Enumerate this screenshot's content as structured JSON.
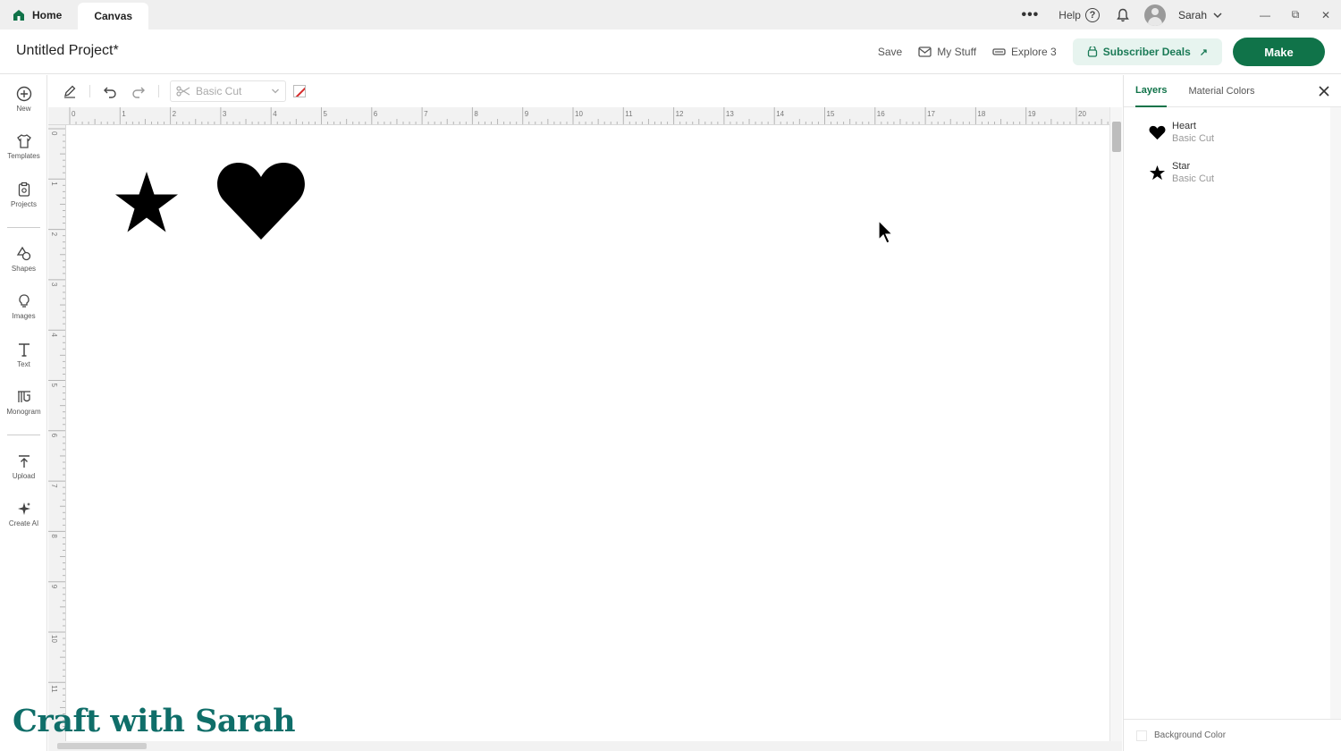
{
  "titlebar": {
    "tabs": [
      {
        "label": "Home"
      },
      {
        "label": "Canvas"
      }
    ],
    "more": "•••",
    "help_label": "Help",
    "help_glyph": "?",
    "user_name": "Sarah",
    "window_controls": {
      "minimize": "—",
      "restore": "⧉",
      "close": "✕"
    }
  },
  "header": {
    "project_title": "Untitled Project*",
    "save_label": "Save",
    "mystuff_label": "My Stuff",
    "machine_label": "Explore 3",
    "deals_label": "Subscriber Deals",
    "deals_arrow": "↗",
    "make_label": "Make"
  },
  "rail": {
    "items": [
      {
        "label": "New",
        "icon": "plus-circle-icon"
      },
      {
        "label": "Templates",
        "icon": "shirt-icon"
      },
      {
        "label": "Projects",
        "icon": "clipboard-icon"
      },
      {
        "label": "Shapes",
        "icon": "shapes-icon"
      },
      {
        "label": "Images",
        "icon": "lightbulb-icon"
      },
      {
        "label": "Text",
        "icon": "text-icon"
      },
      {
        "label": "Monogram",
        "icon": "monogram-icon"
      },
      {
        "label": "Upload",
        "icon": "upload-icon"
      },
      {
        "label": "Create AI",
        "icon": "sparkle-icon"
      }
    ]
  },
  "toolbar": {
    "operation": "Basic Cut"
  },
  "rulers": {
    "h_ticks": [
      "0",
      "1",
      "2",
      "3",
      "4",
      "5",
      "6",
      "7",
      "8",
      "9",
      "10",
      "11",
      "12",
      "13",
      "14",
      "15",
      "16",
      "17",
      "18",
      "19",
      "20"
    ],
    "v_ticks": [
      "0",
      "1",
      "2",
      "3",
      "4",
      "5",
      "6",
      "7",
      "8",
      "9",
      "10",
      "11"
    ]
  },
  "panel": {
    "tabs": [
      {
        "label": "Layers"
      },
      {
        "label": "Material Colors"
      }
    ],
    "layers": [
      {
        "name": "Heart",
        "operation": "Basic Cut",
        "icon": "heart-icon"
      },
      {
        "name": "Star",
        "operation": "Basic Cut",
        "icon": "star-icon"
      }
    ],
    "background_label": "Background Color"
  },
  "colors": {
    "brand_green": "#107349",
    "deals_bg": "#e7f4ef",
    "watermark": "#0f6e69"
  },
  "watermark": "Craft with Sarah"
}
